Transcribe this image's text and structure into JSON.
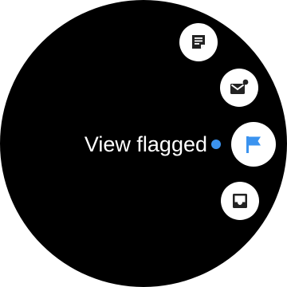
{
  "menu": {
    "selected_label": "View flagged",
    "items": [
      {
        "id": "memo",
        "icon": "note-icon"
      },
      {
        "id": "mail",
        "icon": "new-mail-icon"
      },
      {
        "id": "flag",
        "icon": "flag-icon",
        "selected": true
      },
      {
        "id": "inbox",
        "icon": "inbox-icon"
      }
    ]
  },
  "colors": {
    "background": "#000000",
    "button": "#ffffff",
    "accent": "#3b93ef",
    "icon": "#222222"
  }
}
